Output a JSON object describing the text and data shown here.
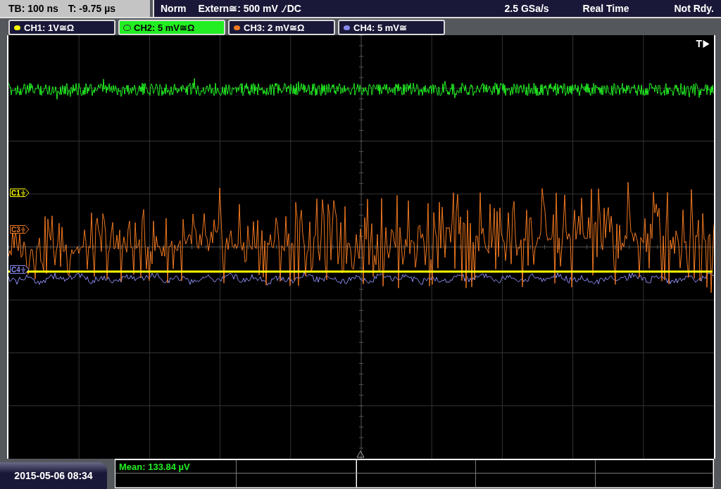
{
  "top_bar": {
    "timebase": "TB: 100 ns",
    "trigger_time": "T: -9.75 µs",
    "mode": "Norm",
    "trigger_source": "Extern≅: 500 mV",
    "coupling": "DC",
    "sample_rate": "2.5 GSa/s",
    "acquisition": "Real Time",
    "status": "Not Rdy."
  },
  "channels": [
    {
      "label": "CH1: 1V≅Ω",
      "color": "#ffff00",
      "selected": false,
      "marker": "C1"
    },
    {
      "label": "CH2: 5 mV≅Ω",
      "color": "#22ee22",
      "selected": true
    },
    {
      "label": "CH3: 2 mV≅Ω",
      "color": "#f07820",
      "selected": false,
      "marker": "C3"
    },
    {
      "label": "CH4: 5 mV≅",
      "color": "#8a8aee",
      "selected": false,
      "marker": "C4"
    }
  ],
  "trigger_marker": "T",
  "date_time": "2015-05-06 08:34",
  "measurements": [
    {
      "text": "Mean: 133.84 µV"
    }
  ]
}
